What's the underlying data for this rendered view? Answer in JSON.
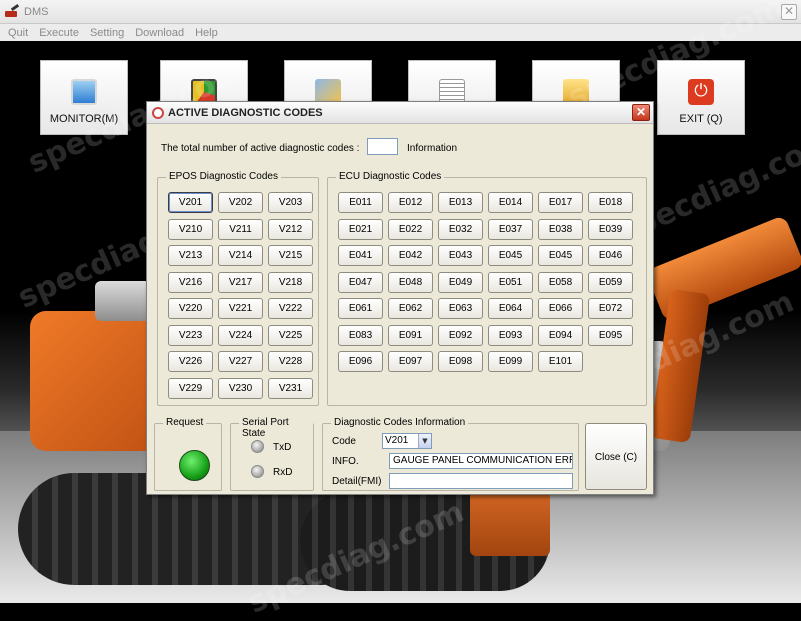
{
  "window": {
    "title": "DMS",
    "close_glyph": "✕"
  },
  "menu": [
    "Quit",
    "Execute",
    "Setting",
    "Download",
    "Help"
  ],
  "toolbar": [
    {
      "name": "monitor",
      "label": "MONITOR(M)",
      "icon": "monitor-icon"
    },
    {
      "name": "chart",
      "label": "",
      "icon": "chart-icon"
    },
    {
      "name": "tools",
      "label": "",
      "icon": "tools-icon"
    },
    {
      "name": "report",
      "label": "",
      "icon": "document-icon"
    },
    {
      "name": "folder",
      "label": "",
      "icon": "folder-icon"
    },
    {
      "name": "exit",
      "label": "EXIT (Q)",
      "icon": "power-icon"
    }
  ],
  "watermark": "specdiag.com",
  "dialog": {
    "title": "ACTIVE DIAGNOSTIC CODES",
    "close_glyph": "✕",
    "total_label": "The total number of active diagnostic codes :",
    "total_value": "",
    "info_label": "Information",
    "epos": {
      "title": "EPOS Diagnostic Codes",
      "codes": [
        "V201",
        "V202",
        "V203",
        "V210",
        "V211",
        "V212",
        "V213",
        "V214",
        "V215",
        "V216",
        "V217",
        "V218",
        "V220",
        "V221",
        "V222",
        "V223",
        "V224",
        "V225",
        "V226",
        "V227",
        "V228",
        "V229",
        "V230",
        "V231"
      ],
      "selected": "V201"
    },
    "ecu": {
      "title": "ECU Diagnostic Codes",
      "codes": [
        "E011",
        "E012",
        "E013",
        "E014",
        "E017",
        "E018",
        "E021",
        "E022",
        "E032",
        "E037",
        "E038",
        "E039",
        "E041",
        "E042",
        "E043",
        "E045",
        "E045",
        "E046",
        "E047",
        "E048",
        "E049",
        "E051",
        "E058",
        "E059",
        "E061",
        "E062",
        "E063",
        "E064",
        "E066",
        "E072",
        "E083",
        "E091",
        "E092",
        "E093",
        "E094",
        "E095",
        "E096",
        "E097",
        "E098",
        "E099",
        "E101"
      ]
    },
    "request": {
      "title": "Request",
      "status_color": "#18a018"
    },
    "serial": {
      "title": "Serial Port State",
      "txd": "TxD",
      "rxd": "RxD"
    },
    "info": {
      "title": "Diagnostic Codes Information",
      "code_label": "Code",
      "code_value": "V201",
      "info_label": "INFO.",
      "info_value": "GAUGE PANEL COMMUNICATION ERROR",
      "detail_label": "Detail(FMI)",
      "detail_value": ""
    },
    "close_label": "Close (C)"
  }
}
